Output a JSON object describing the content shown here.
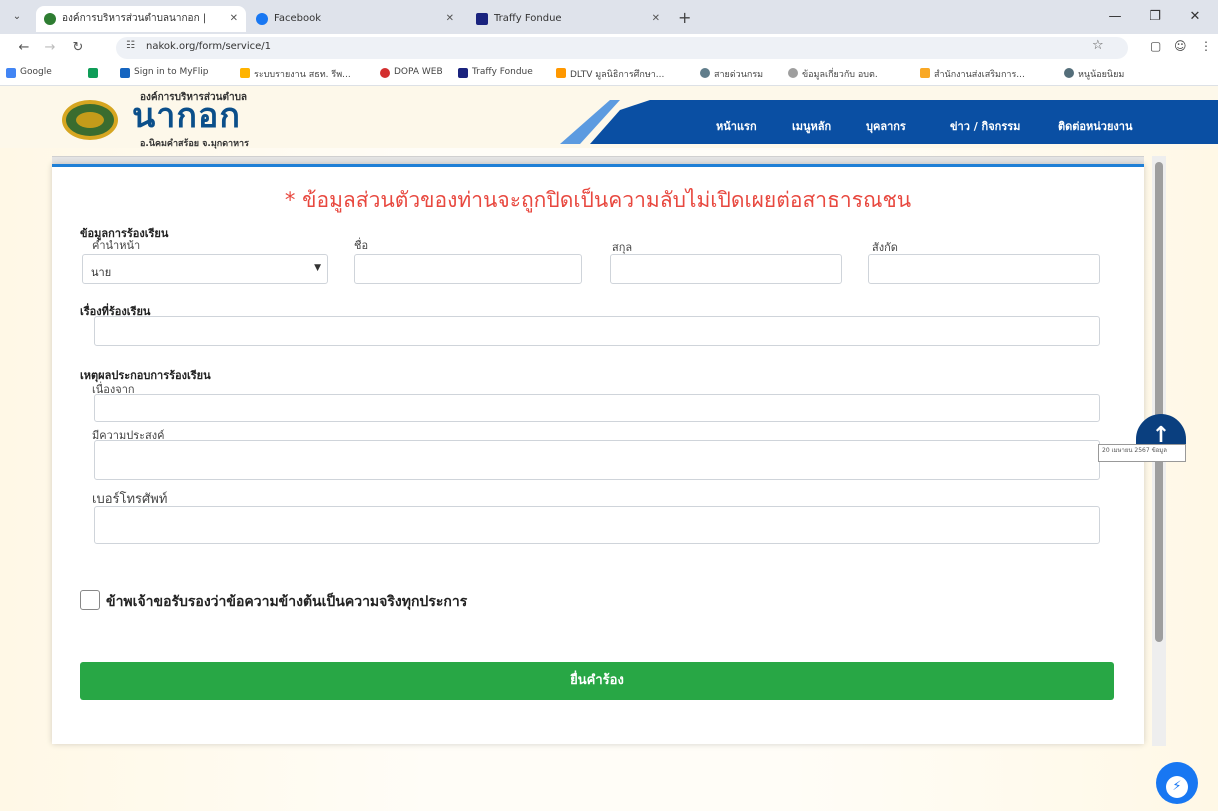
{
  "browser": {
    "tabs": [
      {
        "title": "องค์การบริหารส่วนตำบลนากอก | ",
        "favicon_color": "#2e7d32"
      },
      {
        "title": "Facebook",
        "favicon_color": "#1877f2"
      },
      {
        "title": "Traffy Fondue",
        "favicon_color": "#1a237e"
      }
    ],
    "url": "nakok.org/form/service/1",
    "bookmarks": [
      "Google",
      "Sign in to MyFlip",
      "ระบบรายงาน สธท. รีพ...",
      "DOPA WEB",
      "Traffy Fondue",
      "DLTV มูลนิธิการศึกษา...",
      "สายด่วนกรม",
      "ข้อมูลเกี่ยวกับ อบต.",
      "สำนักงานส่งเสริมการ...",
      "หนูน้อยนิยม"
    ]
  },
  "site": {
    "logo_top": "องค์การบริหารส่วนตำบล",
    "logo_name": "นากอก",
    "logo_bottom": "อ.นิคมคำสร้อย จ.มุกดาหาร",
    "menu": [
      "หน้าแรก",
      "เมนูหลัก",
      "บุคลากร",
      "ข่าว / กิจกรรม",
      "ติดต่อหน่วยงาน"
    ]
  },
  "form": {
    "notice": "* ข้อมูลส่วนตัวของท่านจะถูกปิดเป็นความลับไม่เปิดเผยต่อสาธารณชน",
    "section_complainant": "ข้อมูลการร้องเรียน",
    "label_prefix": "คำนำหน้า",
    "prefix_value": "นาย",
    "label_firstname": "ชื่อ",
    "label_lastname": "สกุล",
    "label_affiliation": "สังกัด",
    "section_subject": "เรื่องที่ร้องเรียน",
    "section_reason": "เหตุผลประกอบการร้องเรียน",
    "label_because": "เนื่องจาก",
    "label_purpose": "มีความประสงค์",
    "label_phone": "เบอร์โทรศัพท์",
    "certify": "ข้าพเจ้าขอรับรองว่าข้อความข้างต้นเป็นความจริงทุกประการ",
    "submit": "ยื่นคำร้อง"
  },
  "widgets": {
    "tooltip": "20 เมษายน 2567 ข้อมูล",
    "scroll_top_icon": "arrow-up-icon",
    "messenger_icon": "messenger-icon"
  },
  "colors": {
    "notice": "#e8483f",
    "menubar": "#0a4fa3",
    "submit": "#28a745",
    "logo_text": "#0b4f8a"
  }
}
